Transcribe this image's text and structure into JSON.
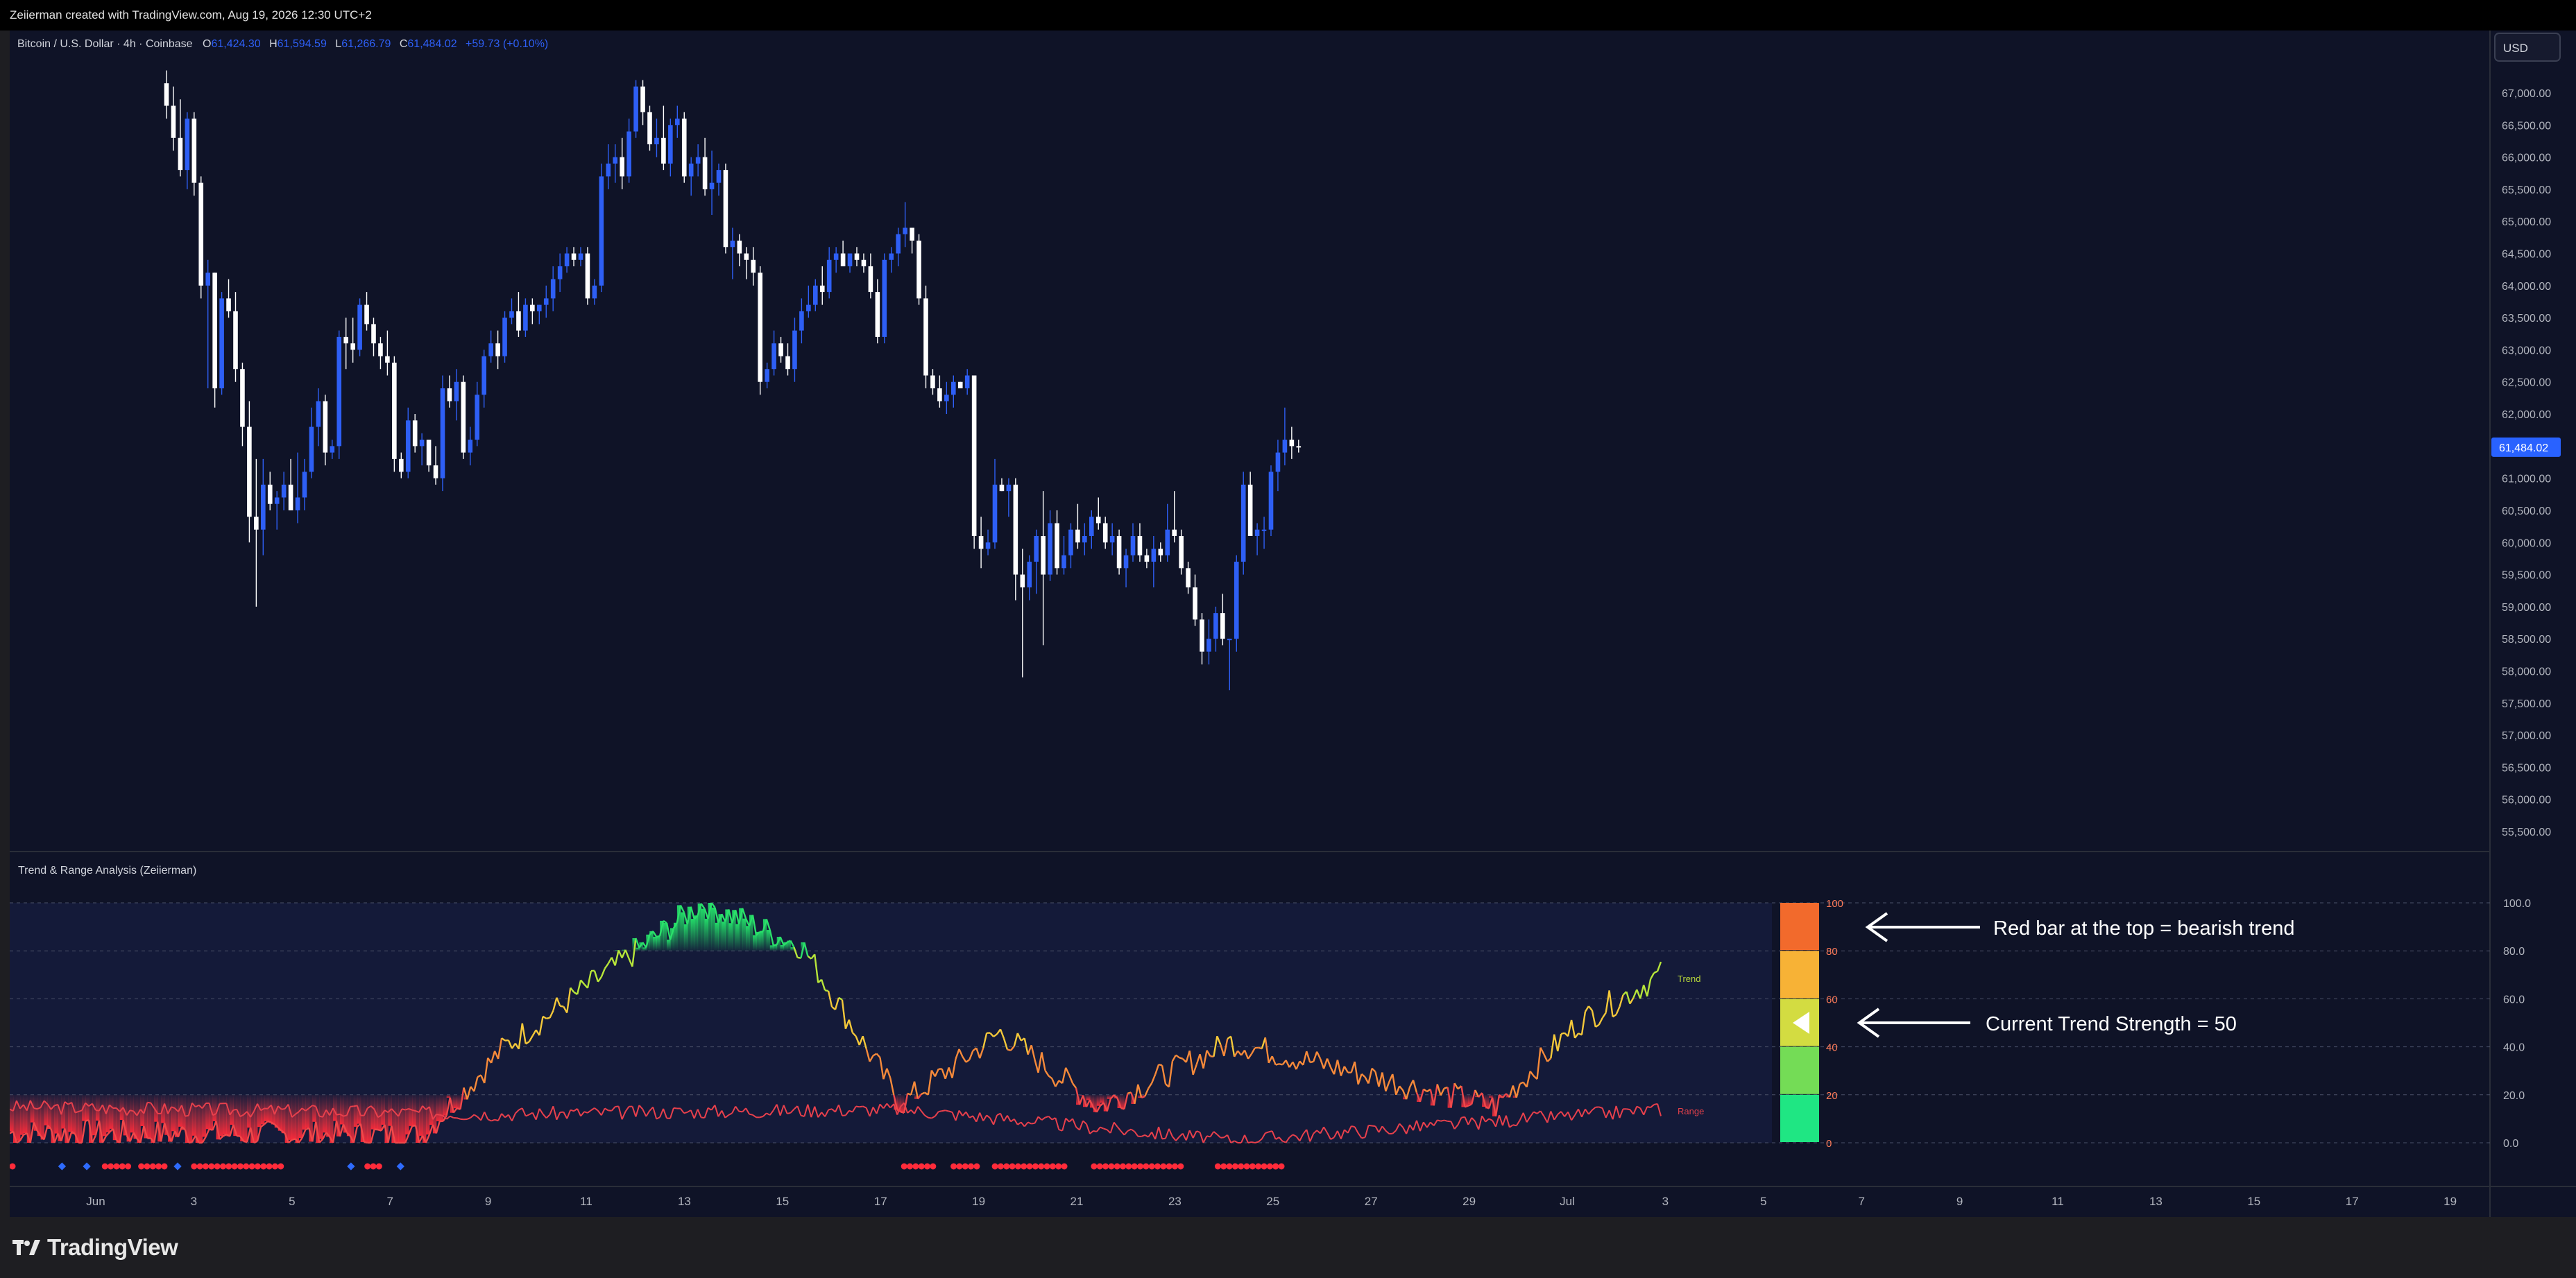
{
  "header": {
    "credit": "Zeiierman created with TradingView.com, Aug 19, 2026 12:30 UTC+2"
  },
  "legend": {
    "symbol": "Bitcoin / U.S. Dollar · 4h · Coinbase",
    "o_label": "O",
    "o_value": "61,424.30",
    "h_label": "H",
    "h_value": "61,594.59",
    "l_label": "L",
    "l_value": "61,266.79",
    "c_label": "C",
    "c_value": "61,484.02",
    "change": "+59.73 (+0.10%)"
  },
  "currency": "USD",
  "last_price": "61,484.02",
  "colors": {
    "up": "#2e5ff5",
    "down": "#ffffff",
    "background": "#0f1327",
    "label_bg": "#2962ff"
  },
  "price_axis": {
    "ticks": [
      "67,000.00",
      "66,500.00",
      "66,000.00",
      "65,500.00",
      "65,000.00",
      "64,500.00",
      "64,000.00",
      "63,500.00",
      "63,000.00",
      "62,500.00",
      "62,000.00",
      "61,500.00",
      "61,000.00",
      "60,500.00",
      "60,000.00",
      "59,500.00",
      "59,000.00",
      "58,500.00",
      "58,000.00",
      "57,500.00",
      "57,000.00",
      "56,500.00",
      "56,000.00",
      "55,500.00"
    ]
  },
  "time_axis": {
    "labels": [
      "Jun",
      "3",
      "5",
      "7",
      "9",
      "11",
      "13",
      "15",
      "17",
      "19",
      "21",
      "23",
      "25",
      "27",
      "29",
      "Jul",
      "3",
      "5",
      "7",
      "9",
      "11",
      "13",
      "15",
      "17",
      "19"
    ]
  },
  "indicator": {
    "title": "Trend & Range Analysis (Zeiierman)",
    "axis_ticks": [
      "100.0",
      "80.0",
      "60.0",
      "40.0",
      "20.0",
      "0.0"
    ],
    "gauge_ticks": [
      "100",
      "80",
      "60",
      "40",
      "20",
      "0"
    ],
    "gauge_colors": [
      "#f26a2c",
      "#f7b236",
      "#d3dc41",
      "#74dc56",
      "#1fe683"
    ],
    "trend_label": "Trend",
    "range_label": "Range",
    "annotation_top": "Red bar at the top = bearish trend",
    "annotation_mid": "Current Trend Strength = 50"
  },
  "footer": {
    "brand": "TradingView"
  },
  "chart_data": {
    "type": "candlestick",
    "title": "Bitcoin / U.S. Dollar · 4h · Coinbase",
    "ylim": [
      55300,
      67300
    ],
    "x_start": "Jun 1",
    "interval": "4h",
    "candles": [
      [
        67150,
        67350,
        66600,
        66800
      ],
      [
        66800,
        67100,
        66100,
        66300
      ],
      [
        66300,
        66900,
        65700,
        65800
      ],
      [
        65800,
        66700,
        65500,
        66600
      ],
      [
        66600,
        66700,
        65400,
        65600
      ],
      [
        65600,
        65700,
        63800,
        64000
      ],
      [
        64000,
        64400,
        62400,
        64200
      ],
      [
        64200,
        64200,
        62100,
        62400
      ],
      [
        62400,
        63900,
        62300,
        63800
      ],
      [
        63800,
        64100,
        63500,
        63600
      ],
      [
        63600,
        63900,
        62500,
        62700
      ],
      [
        62700,
        62800,
        61500,
        61800
      ],
      [
        61800,
        62200,
        60000,
        60400
      ],
      [
        60400,
        61300,
        59000,
        60200
      ],
      [
        60200,
        61300,
        59800,
        60900
      ],
      [
        60900,
        61100,
        60500,
        60600
      ],
      [
        60600,
        60800,
        60200,
        60700
      ],
      [
        60700,
        61100,
        60500,
        60900
      ],
      [
        60900,
        61300,
        60500,
        60500
      ],
      [
        60500,
        61400,
        60300,
        60700
      ],
      [
        60700,
        61300,
        60500,
        61100
      ],
      [
        61100,
        62100,
        61000,
        61800
      ],
      [
        61800,
        62400,
        61500,
        62200
      ],
      [
        62200,
        62300,
        61200,
        61400
      ],
      [
        61400,
        61600,
        61300,
        61500
      ],
      [
        61500,
        63300,
        61300,
        63200
      ],
      [
        63200,
        63500,
        62700,
        63100
      ],
      [
        63100,
        63500,
        62800,
        63000
      ],
      [
        63000,
        63800,
        62900,
        63700
      ],
      [
        63700,
        63900,
        63300,
        63400
      ],
      [
        63400,
        63500,
        62900,
        63100
      ],
      [
        63100,
        63200,
        62700,
        62900
      ],
      [
        62900,
        63300,
        62600,
        62800
      ],
      [
        62800,
        62900,
        61100,
        61300
      ],
      [
        61300,
        61400,
        61000,
        61100
      ],
      [
        61100,
        62100,
        61000,
        61900
      ],
      [
        61900,
        62000,
        61400,
        61500
      ],
      [
        61500,
        61700,
        61200,
        61600
      ],
      [
        61600,
        61600,
        61100,
        61200
      ],
      [
        61200,
        61500,
        60900,
        61000
      ],
      [
        61000,
        62600,
        60800,
        62400
      ],
      [
        62400,
        62600,
        62100,
        62200
      ],
      [
        62200,
        62700,
        61900,
        62500
      ],
      [
        62500,
        62600,
        61300,
        61400
      ],
      [
        61400,
        61800,
        61200,
        61600
      ],
      [
        61600,
        62500,
        61500,
        62300
      ],
      [
        62300,
        63000,
        62100,
        62900
      ],
      [
        62900,
        63300,
        62800,
        63100
      ],
      [
        63100,
        63300,
        62700,
        62900
      ],
      [
        62900,
        63600,
        62800,
        63500
      ],
      [
        63500,
        63800,
        63400,
        63600
      ],
      [
        63600,
        63900,
        63200,
        63300
      ],
      [
        63300,
        63800,
        63200,
        63700
      ],
      [
        63700,
        63800,
        63400,
        63600
      ],
      [
        63600,
        63700,
        63400,
        63700
      ],
      [
        63700,
        64000,
        63500,
        63800
      ],
      [
        63800,
        64300,
        63600,
        64100
      ],
      [
        64100,
        64500,
        63900,
        64300
      ],
      [
        64300,
        64600,
        64200,
        64500
      ],
      [
        64500,
        64600,
        64300,
        64400
      ],
      [
        64400,
        64600,
        64300,
        64500
      ],
      [
        64500,
        64600,
        63700,
        63800
      ],
      [
        63800,
        64100,
        63700,
        64000
      ],
      [
        64000,
        65900,
        63900,
        65700
      ],
      [
        65700,
        66200,
        65500,
        65900
      ],
      [
        65900,
        66200,
        65600,
        66000
      ],
      [
        66000,
        66300,
        65500,
        65700
      ],
      [
        65700,
        66600,
        65600,
        66400
      ],
      [
        66400,
        67200,
        66300,
        67100
      ],
      [
        67100,
        67200,
        66500,
        66700
      ],
      [
        66700,
        66800,
        66100,
        66200
      ],
      [
        66200,
        66600,
        66000,
        66300
      ],
      [
        66300,
        66800,
        65800,
        65900
      ],
      [
        65900,
        66600,
        65700,
        66500
      ],
      [
        66500,
        66800,
        66300,
        66600
      ],
      [
        66600,
        66700,
        65600,
        65700
      ],
      [
        65700,
        66000,
        65400,
        65900
      ],
      [
        65900,
        66200,
        65700,
        66000
      ],
      [
        66000,
        66300,
        65400,
        65500
      ],
      [
        65500,
        66100,
        65100,
        65600
      ],
      [
        65600,
        65900,
        65400,
        65800
      ],
      [
        65800,
        65900,
        64500,
        64600
      ],
      [
        64600,
        64900,
        64100,
        64700
      ],
      [
        64700,
        64800,
        64300,
        64500
      ],
      [
        64500,
        64600,
        64100,
        64400
      ],
      [
        64400,
        64600,
        64000,
        64200
      ],
      [
        64200,
        64300,
        62300,
        62500
      ],
      [
        62500,
        62800,
        62400,
        62700
      ],
      [
        62700,
        63300,
        62600,
        63100
      ],
      [
        63100,
        63200,
        62800,
        62900
      ],
      [
        62900,
        63100,
        62600,
        62700
      ],
      [
        62700,
        63500,
        62500,
        63300
      ],
      [
        63300,
        63800,
        63100,
        63600
      ],
      [
        63600,
        64000,
        63500,
        63700
      ],
      [
        63700,
        64100,
        63600,
        64000
      ],
      [
        64000,
        64300,
        63700,
        63900
      ],
      [
        63900,
        64600,
        63800,
        64400
      ],
      [
        64400,
        64600,
        64200,
        64500
      ],
      [
        64500,
        64700,
        64300,
        64300
      ],
      [
        64300,
        64500,
        64200,
        64500
      ],
      [
        64500,
        64600,
        64300,
        64400
      ],
      [
        64400,
        64500,
        64200,
        64300
      ],
      [
        64300,
        64500,
        63800,
        63900
      ],
      [
        63900,
        64100,
        63100,
        63200
      ],
      [
        63200,
        64500,
        63100,
        64400
      ],
      [
        64400,
        64600,
        64200,
        64500
      ],
      [
        64500,
        64900,
        64300,
        64800
      ],
      [
        64800,
        65300,
        64600,
        64900
      ],
      [
        64900,
        64900,
        64500,
        64700
      ],
      [
        64700,
        64800,
        63700,
        63800
      ],
      [
        63800,
        64000,
        62400,
        62600
      ],
      [
        62600,
        62700,
        62300,
        62400
      ],
      [
        62400,
        62600,
        62100,
        62200
      ],
      [
        62200,
        62500,
        62000,
        62300
      ],
      [
        62300,
        62600,
        62100,
        62500
      ],
      [
        62500,
        62500,
        62400,
        62400
      ],
      [
        62400,
        62700,
        62300,
        62600
      ],
      [
        62600,
        62600,
        59900,
        60100
      ],
      [
        60100,
        60400,
        59600,
        59900
      ],
      [
        59900,
        60200,
        59800,
        60000
      ],
      [
        60000,
        61300,
        59900,
        60900
      ],
      [
        60900,
        61000,
        60800,
        60800
      ],
      [
        60800,
        61000,
        60400,
        60900
      ],
      [
        60900,
        61000,
        59100,
        59500
      ],
      [
        59500,
        59900,
        57900,
        59300
      ],
      [
        59300,
        59800,
        59100,
        59700
      ],
      [
        59700,
        60200,
        59200,
        60100
      ],
      [
        60100,
        60800,
        58400,
        59500
      ],
      [
        59500,
        60500,
        59400,
        60300
      ],
      [
        60300,
        60500,
        59500,
        59600
      ],
      [
        59600,
        60100,
        59500,
        59800
      ],
      [
        59800,
        60300,
        59600,
        60200
      ],
      [
        60200,
        60600,
        59900,
        60000
      ],
      [
        60000,
        60300,
        59800,
        60100
      ],
      [
        60100,
        60500,
        59900,
        60400
      ],
      [
        60400,
        60700,
        60200,
        60300
      ],
      [
        60300,
        60400,
        59900,
        60000
      ],
      [
        60000,
        60300,
        59800,
        60100
      ],
      [
        60100,
        60200,
        59500,
        59600
      ],
      [
        59600,
        59900,
        59300,
        59800
      ],
      [
        59800,
        60300,
        59700,
        60100
      ],
      [
        60100,
        60300,
        59700,
        59800
      ],
      [
        59800,
        59900,
        59600,
        59700
      ],
      [
        59700,
        60100,
        59300,
        59900
      ],
      [
        59900,
        60000,
        59700,
        59800
      ],
      [
        59800,
        60600,
        59700,
        60200
      ],
      [
        60200,
        60800,
        60000,
        60100
      ],
      [
        60100,
        60200,
        59500,
        59600
      ],
      [
        59600,
        59700,
        59200,
        59300
      ],
      [
        59300,
        59500,
        58700,
        58800
      ],
      [
        58800,
        58900,
        58100,
        58300
      ],
      [
        58300,
        58800,
        58100,
        58500
      ],
      [
        58500,
        59000,
        58300,
        58900
      ],
      [
        58900,
        59200,
        58400,
        58500
      ],
      [
        58500,
        58500,
        57700,
        58500
      ],
      [
        58500,
        59800,
        58300,
        59700
      ],
      [
        59700,
        61100,
        59500,
        60900
      ],
      [
        60900,
        61100,
        60100,
        60100
      ],
      [
        60100,
        60300,
        59800,
        60200
      ],
      [
        60200,
        60400,
        59900,
        60200
      ],
      [
        60200,
        61200,
        60100,
        61100
      ],
      [
        61100,
        61600,
        60800,
        61400
      ],
      [
        61400,
        62100,
        61200,
        61600
      ],
      [
        61600,
        61800,
        61300,
        61500
      ],
      [
        61500,
        61600,
        61400,
        61484
      ]
    ],
    "trend": [
      {
        "x": 0,
        "y": 4
      },
      {
        "x": 0.25,
        "y": 3
      },
      {
        "x": 0.3,
        "y": 40
      },
      {
        "x": 0.42,
        "y": 100
      },
      {
        "x": 0.48,
        "y": 82
      },
      {
        "x": 0.54,
        "y": 16
      },
      {
        "x": 0.6,
        "y": 46
      },
      {
        "x": 0.66,
        "y": 15
      },
      {
        "x": 0.74,
        "y": 42
      },
      {
        "x": 0.9,
        "y": 15
      },
      {
        "x": 0.95,
        "y": 50
      },
      {
        "x": 1,
        "y": 70
      }
    ],
    "range": [
      {
        "x": 0,
        "y": 15
      },
      {
        "x": 0.3,
        "y": 12
      },
      {
        "x": 0.54,
        "y": 14
      },
      {
        "x": 0.74,
        "y": 1
      },
      {
        "x": 1,
        "y": 14
      }
    ]
  }
}
